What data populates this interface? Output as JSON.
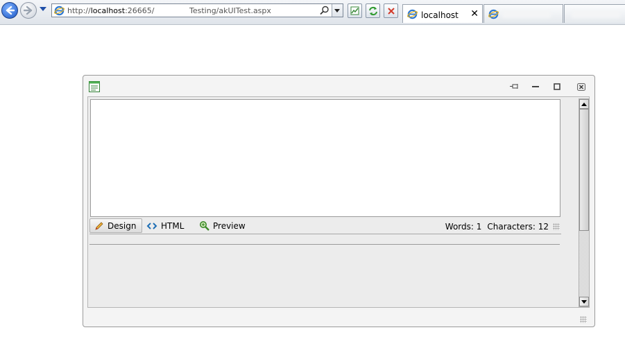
{
  "browser": {
    "address": {
      "url_prefix": "http://",
      "url_host": "localhost",
      "url_port": ":26665/",
      "url_path": "Testing/akUITest.aspx"
    },
    "tabs": [
      {
        "label": "localhost",
        "close": "✕"
      }
    ]
  },
  "editor": {
    "modes": [
      {
        "label": "Design",
        "icon": "pencil-icon"
      },
      {
        "label": "HTML",
        "icon": "code-brackets-icon"
      },
      {
        "label": "Preview",
        "icon": "magnifier-icon"
      }
    ],
    "words_label": "Words: 1",
    "chars_label": "Characters: 12"
  },
  "colors": {
    "accent": "#1a56c4",
    "window_bg": "#f4f4f4",
    "panel_bg": "#ececec"
  }
}
